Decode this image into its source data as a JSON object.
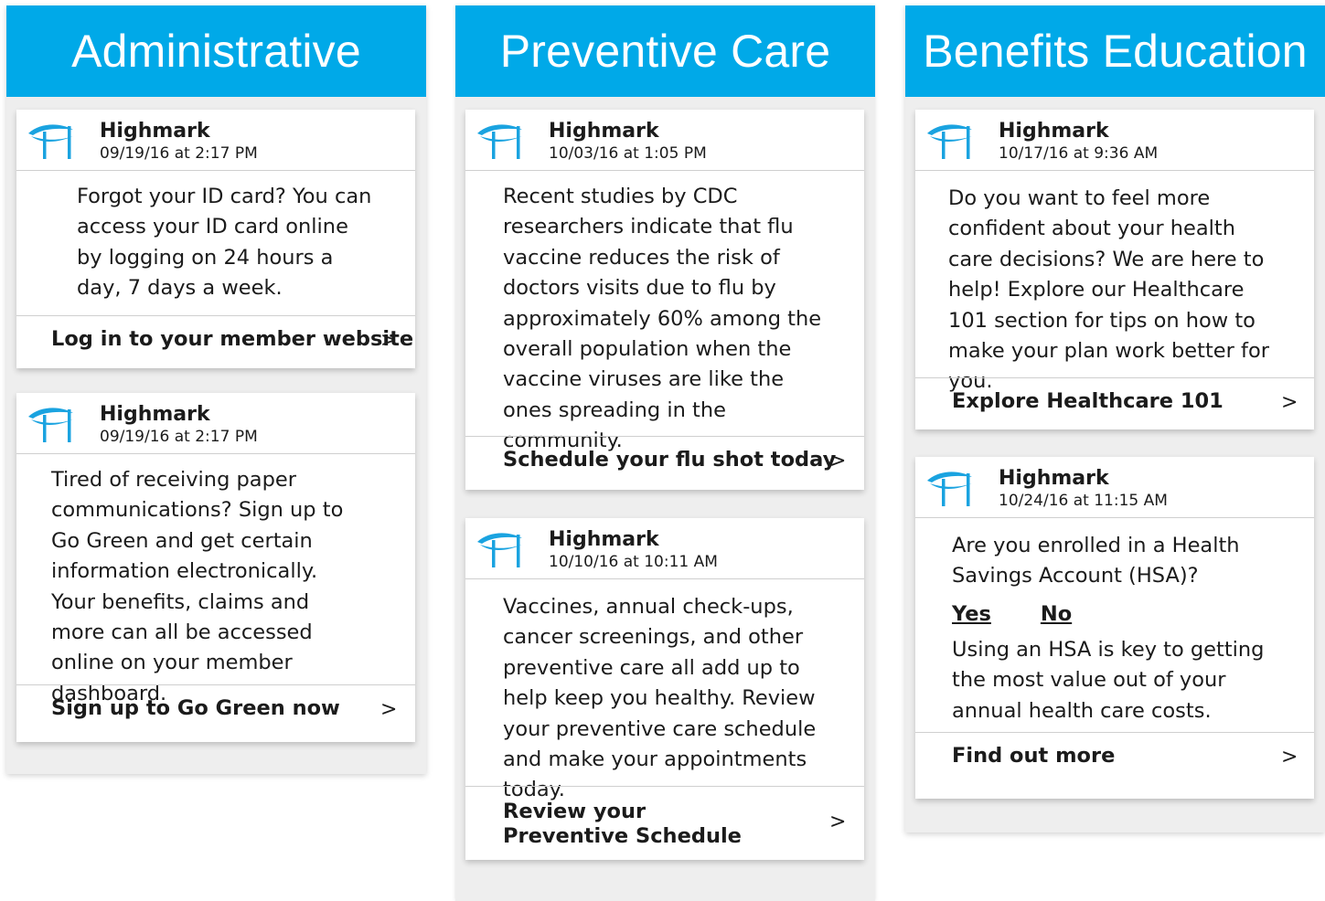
{
  "columns": [
    {
      "title": "Administrative",
      "cards": [
        {
          "sender": "Highmark",
          "timestamp": "09/19/16 at 2:17 PM",
          "body": "Forgot your ID card? You can access your ID card online by logging on 24 hours a day, 7 days a week.",
          "cta": "Log in to your member website",
          "chevron": ">"
        },
        {
          "sender": "Highmark",
          "timestamp": "09/19/16 at 2:17 PM",
          "body": "Tired of receiving paper communications? Sign up to Go Green and get certain information electronically. Your benefits, claims and more can all be accessed online on your member dashboard.",
          "cta": "Sign up to Go Green now",
          "chevron": ">"
        }
      ]
    },
    {
      "title": "Preventive Care",
      "cards": [
        {
          "sender": "Highmark",
          "timestamp": "10/03/16 at 1:05 PM",
          "body": "Recent studies by CDC researchers indicate that flu vaccine reduces the risk of doctors visits due to flu by approximately 60% among the overall population when the vaccine viruses are like the ones spreading in the community.",
          "cta": "Schedule your flu shot today",
          "chevron": ">"
        },
        {
          "sender": "Highmark",
          "timestamp": "10/10/16 at 10:11 AM",
          "body": "Vaccines, annual check-ups, cancer screenings, and other preventive care all add up to help keep you healthy. Review your preventive care schedule and make your appointments today.",
          "cta_line1": "Review your",
          "cta_line2": "Preventive Schedule",
          "chevron": ">"
        }
      ]
    },
    {
      "title": "Benefits Education",
      "cards": [
        {
          "sender": "Highmark",
          "timestamp": "10/17/16 at 9:36 AM",
          "body": "Do you want to feel more confident about your health care decisions? We are here to help! Explore our Healthcare 101 section for tips on how to make your plan work better for you.",
          "cta": "Explore Healthcare 101",
          "chevron": ">"
        },
        {
          "sender": "Highmark",
          "timestamp": "10/24/16 at 11:15 AM",
          "question": "Are you enrolled in a Health Savings Account (HSA)?",
          "yes_label": "Yes",
          "no_label": "No",
          "body": "Using an HSA is key to getting the most value out of your annual health care costs.",
          "cta": "Find out more",
          "chevron": ">"
        }
      ]
    }
  ],
  "colors": {
    "header_blue": "#00a9e8",
    "logo_blue": "#1aa3e0",
    "column_bg": "#eeeeee"
  },
  "icons": {
    "logo": "highmark-logo-icon",
    "chevron": "chevron-right-icon"
  }
}
